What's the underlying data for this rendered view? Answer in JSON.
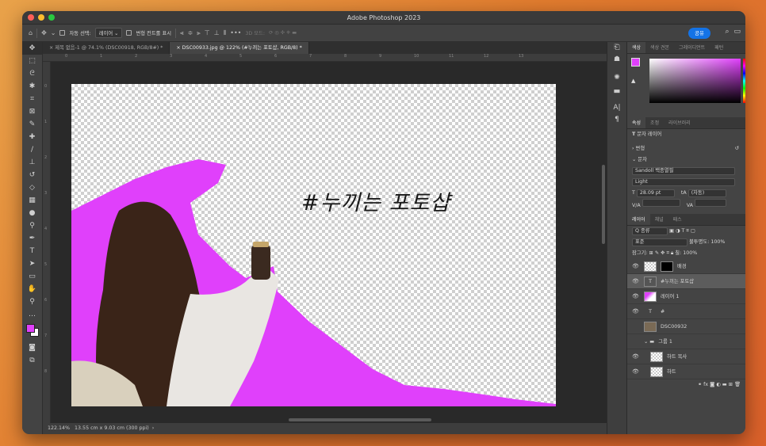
{
  "app": {
    "title": "Adobe Photoshop 2023"
  },
  "colors": {
    "magenta": "#e040fb",
    "accent": "#1473e6"
  },
  "options_bar": {
    "auto_select_label": "자동 선택:",
    "auto_select_value": "레이어",
    "transform_controls_label": "변형 컨트롤 표시",
    "mode_3d_label": "3D 모드:",
    "share_label": "공유"
  },
  "tabs": [
    {
      "label": "제목 없음-1 @ 74.1% (DSC00918, RGB/8#) *"
    },
    {
      "label": "DSC00933.jpg @ 122% (#누끼는 포토샵, RGB/8) *"
    }
  ],
  "ruler": {
    "ticks": [
      "0",
      "1",
      "2",
      "3",
      "4",
      "5",
      "6",
      "7",
      "8",
      "9",
      "10",
      "11",
      "12",
      "13"
    ],
    "vticks": [
      "0",
      "1",
      "2",
      "3",
      "4",
      "5",
      "6",
      "7",
      "8"
    ]
  },
  "canvas": {
    "headline": "#누끼는 포토샵"
  },
  "status": {
    "zoom": "122.14%",
    "doc_size": "13.55 cm x 9.03 cm (300 ppi)",
    "arrow": "›"
  },
  "color_panel": {
    "tabs": [
      "색상",
      "색상 견본",
      "그레이디언트",
      "패턴"
    ]
  },
  "properties_panel": {
    "tabs": [
      "속성",
      "조정",
      "라이브러리"
    ],
    "layer_kind": "문자 레이어",
    "transform_label": "변형",
    "text_label": "문자",
    "font_family": "Sandoll 백종열필",
    "font_style": "Light",
    "font_size": "28.09 pt",
    "leading": "(자동)",
    "kerning_label": "V/A",
    "tracking_label": "VA"
  },
  "layers_panel": {
    "tabs": [
      "레이어",
      "채널",
      "패스"
    ],
    "filter_label": "Q 종류",
    "blend_mode": "표준",
    "opacity_label": "불투명도:",
    "opacity": "100%",
    "lock_label": "잠그기:",
    "fill_label": "칠:",
    "fill": "100%",
    "layers": [
      {
        "name": "배경",
        "type": "image-mask",
        "visible": true,
        "selected": false
      },
      {
        "name": "#누끼는 포토샵",
        "type": "text",
        "visible": true,
        "selected": true
      },
      {
        "name": "레이어 1",
        "type": "paint",
        "visible": true,
        "selected": false
      },
      {
        "name": "#",
        "type": "text",
        "visible": true,
        "selected": false
      },
      {
        "name": "DSC00932",
        "type": "smart",
        "visible": false,
        "selected": false
      },
      {
        "name": "그룹 1",
        "type": "group",
        "visible": false,
        "selected": false
      },
      {
        "name": "하트 복사",
        "type": "smart",
        "visible": true,
        "selected": false
      },
      {
        "name": "하트",
        "type": "smart",
        "visible": true,
        "selected": false
      }
    ],
    "footer_fx": "fx"
  }
}
